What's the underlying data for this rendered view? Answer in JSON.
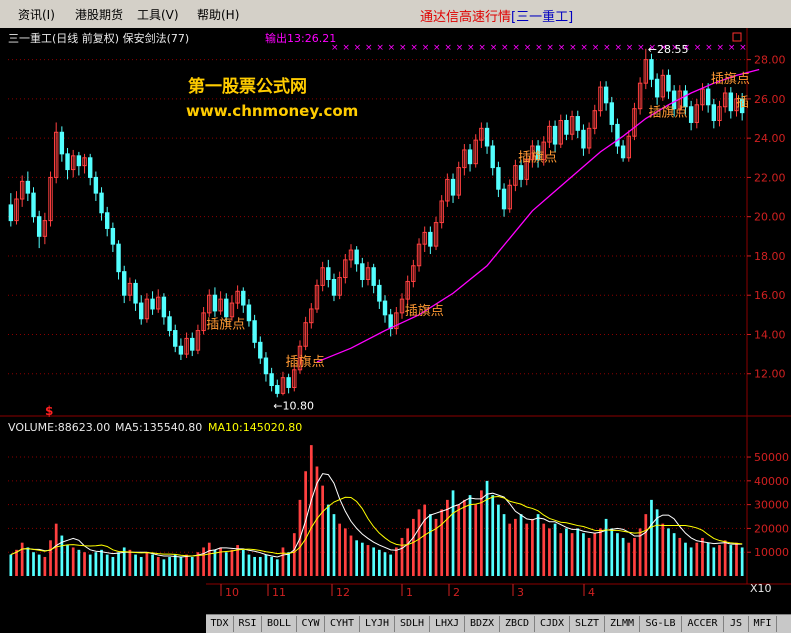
{
  "menu": {
    "items": [
      "资讯(I)",
      "港股期货",
      "工具(V)",
      "帮助(H)"
    ]
  },
  "app": {
    "title": "通达信高速行情",
    "stock_tag": "[三一重工]"
  },
  "price_panel": {
    "header": "三一重工(日线 前复权) 保安剑法(77)",
    "output_label": "输出13:26.21",
    "watermark_line1": "第一股票公式网",
    "watermark_line2": "www.chnmoney.com",
    "max_label": "28.55",
    "min_label": "10.80",
    "signal_label": "插旗点",
    "signal_label_partial": "插",
    "dollar_marker": "$"
  },
  "volume_panel": {
    "label_volume": "VOLUME:88623.00",
    "label_ma5": "MA5:135540.80",
    "label_ma10": "MA10:145020.80",
    "scale_label": "X10"
  },
  "time_axis": {
    "labels": [
      "10",
      "11",
      "12",
      "1",
      "2",
      "3",
      "4"
    ]
  },
  "tabs": [
    "TDX",
    "RSI",
    "BOLL",
    "CYW",
    "CYHT",
    "LYJH",
    "SDLH",
    "LHXJ",
    "BDZX",
    "ZBCD",
    "CJDX",
    "SLZT",
    "ZLMM",
    "SG-LB",
    "ACCER",
    "JS",
    "MFI"
  ],
  "colors": {
    "up": "#ff4040",
    "down": "#54ffff",
    "ma_line": "#ff00ff",
    "ma5": "#ffffff",
    "ma10": "#ffff00",
    "signal": "#ff9933",
    "watermark": "#ffcc00",
    "grid": "#8b0000",
    "axis_text": "#d02020"
  },
  "chart_data": [
    {
      "type": "candlestick",
      "title": "三一重工(日线 前复权) 保安剑法(77)",
      "y_ticks": [
        12.0,
        14.0,
        16.0,
        18.0,
        20.0,
        22.0,
        24.0,
        26.0,
        28.0
      ],
      "ylim": [
        10.0,
        29.0
      ],
      "annotations": [
        {
          "text": "10.80",
          "value": 10.8,
          "kind": "min"
        },
        {
          "text": "28.55",
          "value": 28.55,
          "kind": "max"
        },
        {
          "text": "插旗点",
          "bar": 38,
          "price": 14.3
        },
        {
          "text": "插旗点",
          "bar": 52,
          "price": 12.4
        },
        {
          "text": "插旗点",
          "bar": 73,
          "price": 15.0
        },
        {
          "text": "插旗点",
          "bar": 93,
          "price": 22.8
        },
        {
          "text": "插旗点",
          "bar": 116,
          "price": 25.1
        },
        {
          "text": "插旗点",
          "bar": 127,
          "price": 26.8
        }
      ],
      "signal_line": [
        [
          54,
          12.6
        ],
        [
          60,
          13.3
        ],
        [
          66,
          14.2
        ],
        [
          72,
          15.0
        ],
        [
          78,
          16.1
        ],
        [
          84,
          17.5
        ],
        [
          88,
          18.9
        ],
        [
          92,
          20.3
        ],
        [
          96,
          21.3
        ],
        [
          100,
          22.3
        ],
        [
          104,
          23.3
        ],
        [
          108,
          24.1
        ],
        [
          112,
          25.0
        ],
        [
          116,
          25.7
        ],
        [
          120,
          26.3
        ],
        [
          124,
          26.8
        ],
        [
          128,
          27.2
        ],
        [
          132,
          27.5
        ]
      ],
      "cross_markers_from_bar": 57,
      "candles": [
        [
          20.6,
          19.8,
          21.2,
          19.5
        ],
        [
          19.8,
          20.9,
          21.3,
          19.6
        ],
        [
          20.9,
          21.8,
          22.1,
          20.5
        ],
        [
          21.8,
          21.2,
          22.3,
          20.8
        ],
        [
          21.2,
          20.0,
          21.5,
          19.7
        ],
        [
          20.0,
          19.0,
          20.3,
          18.4
        ],
        [
          19.0,
          19.8,
          20.2,
          18.6
        ],
        [
          19.8,
          22.0,
          22.3,
          19.5
        ],
        [
          22.0,
          24.3,
          24.8,
          21.7
        ],
        [
          24.3,
          23.2,
          24.6,
          22.8
        ],
        [
          23.2,
          22.4,
          23.5,
          21.9
        ],
        [
          22.4,
          23.1,
          23.4,
          22.0
        ],
        [
          23.1,
          22.6,
          23.3,
          22.1
        ],
        [
          22.6,
          23.0,
          23.2,
          22.2
        ],
        [
          23.0,
          22.0,
          23.2,
          21.6
        ],
        [
          22.0,
          21.2,
          22.3,
          20.8
        ],
        [
          21.2,
          20.2,
          21.5,
          19.8
        ],
        [
          20.2,
          19.4,
          20.5,
          19.0
        ],
        [
          19.4,
          18.6,
          19.7,
          18.2
        ],
        [
          18.6,
          17.2,
          18.8,
          16.8
        ],
        [
          17.2,
          16.0,
          17.5,
          15.6
        ],
        [
          16.0,
          16.6,
          16.9,
          15.7
        ],
        [
          16.6,
          15.6,
          16.8,
          15.2
        ],
        [
          15.6,
          14.8,
          16.0,
          14.5
        ],
        [
          14.8,
          15.8,
          16.1,
          14.6
        ],
        [
          15.8,
          15.3,
          16.2,
          15.0
        ],
        [
          15.3,
          15.9,
          16.3,
          15.1
        ],
        [
          15.9,
          14.9,
          16.1,
          14.5
        ],
        [
          14.9,
          14.2,
          15.2,
          13.9
        ],
        [
          14.2,
          13.4,
          14.5,
          13.1
        ],
        [
          13.4,
          13.0,
          13.8,
          12.7
        ],
        [
          13.0,
          13.8,
          14.1,
          12.8
        ],
        [
          13.8,
          13.2,
          14.1,
          12.9
        ],
        [
          13.2,
          14.2,
          14.5,
          13.0
        ],
        [
          14.2,
          15.1,
          15.4,
          14.0
        ],
        [
          15.1,
          16.0,
          16.3,
          14.9
        ],
        [
          16.0,
          15.2,
          16.4,
          14.9
        ],
        [
          15.2,
          15.8,
          16.2,
          15.0
        ],
        [
          15.8,
          14.9,
          16.1,
          14.6
        ],
        [
          14.9,
          15.6,
          16.0,
          14.7
        ],
        [
          15.6,
          16.2,
          16.5,
          15.3
        ],
        [
          16.2,
          15.5,
          16.4,
          15.1
        ],
        [
          15.5,
          14.7,
          15.8,
          14.4
        ],
        [
          14.7,
          13.6,
          15.0,
          13.3
        ],
        [
          13.6,
          12.8,
          13.9,
          12.5
        ],
        [
          12.8,
          12.0,
          13.1,
          11.6
        ],
        [
          12.0,
          11.4,
          12.3,
          11.1
        ],
        [
          11.4,
          11.0,
          11.7,
          10.8
        ],
        [
          11.0,
          11.8,
          12.1,
          10.9
        ],
        [
          11.8,
          11.3,
          12.0,
          11.0
        ],
        [
          11.3,
          12.2,
          12.5,
          11.1
        ],
        [
          12.2,
          13.4,
          13.7,
          12.0
        ],
        [
          13.4,
          14.6,
          14.9,
          13.2
        ],
        [
          14.6,
          15.3,
          15.6,
          14.3
        ],
        [
          15.3,
          16.5,
          16.8,
          15.1
        ],
        [
          16.5,
          17.4,
          17.7,
          16.2
        ],
        [
          17.4,
          16.8,
          17.8,
          16.4
        ],
        [
          16.8,
          16.0,
          17.1,
          15.7
        ],
        [
          16.0,
          16.9,
          17.2,
          15.8
        ],
        [
          16.9,
          17.8,
          18.1,
          16.6
        ],
        [
          17.8,
          18.3,
          18.6,
          17.4
        ],
        [
          18.3,
          17.6,
          18.5,
          17.2
        ],
        [
          17.6,
          16.8,
          17.9,
          16.4
        ],
        [
          16.8,
          17.4,
          17.7,
          16.5
        ],
        [
          17.4,
          16.5,
          17.6,
          16.1
        ],
        [
          16.5,
          15.7,
          16.8,
          15.3
        ],
        [
          15.7,
          15.0,
          16.0,
          14.6
        ],
        [
          15.0,
          14.3,
          15.3,
          13.9
        ],
        [
          14.3,
          15.1,
          15.4,
          14.0
        ],
        [
          15.1,
          15.8,
          16.1,
          14.8
        ],
        [
          15.8,
          16.7,
          17.0,
          15.5
        ],
        [
          16.7,
          17.5,
          17.8,
          16.4
        ],
        [
          17.5,
          18.6,
          18.9,
          17.2
        ],
        [
          18.6,
          19.2,
          19.5,
          18.2
        ],
        [
          19.2,
          18.5,
          19.5,
          18.1
        ],
        [
          18.5,
          19.7,
          20.0,
          18.3
        ],
        [
          19.7,
          20.8,
          21.1,
          19.4
        ],
        [
          20.8,
          21.9,
          22.2,
          20.5
        ],
        [
          21.9,
          21.1,
          22.2,
          20.7
        ],
        [
          21.1,
          22.5,
          22.8,
          20.9
        ],
        [
          22.5,
          23.4,
          23.7,
          22.1
        ],
        [
          23.4,
          22.7,
          23.7,
          22.3
        ],
        [
          22.7,
          23.9,
          24.2,
          22.5
        ],
        [
          23.9,
          24.5,
          24.8,
          23.5
        ],
        [
          24.5,
          23.6,
          24.8,
          23.2
        ],
        [
          23.6,
          22.5,
          23.9,
          22.1
        ],
        [
          22.5,
          21.4,
          22.8,
          21.0
        ],
        [
          21.4,
          20.4,
          21.7,
          20.0
        ],
        [
          20.4,
          21.6,
          21.9,
          20.2
        ],
        [
          21.6,
          22.6,
          22.9,
          21.3
        ],
        [
          22.6,
          21.9,
          22.9,
          21.5
        ],
        [
          21.9,
          22.9,
          23.2,
          21.6
        ],
        [
          22.9,
          23.6,
          23.9,
          22.5
        ],
        [
          23.6,
          22.9,
          23.9,
          22.5
        ],
        [
          22.9,
          23.8,
          24.1,
          22.6
        ],
        [
          23.8,
          24.6,
          24.9,
          23.5
        ],
        [
          24.6,
          23.7,
          24.9,
          23.3
        ],
        [
          23.7,
          24.9,
          25.2,
          23.5
        ],
        [
          24.9,
          24.2,
          25.2,
          23.9
        ],
        [
          24.2,
          25.1,
          25.4,
          23.9
        ],
        [
          25.1,
          24.4,
          25.4,
          24.0
        ],
        [
          24.4,
          23.5,
          24.7,
          23.1
        ],
        [
          23.5,
          24.5,
          24.8,
          23.2
        ],
        [
          24.5,
          25.4,
          25.7,
          24.2
        ],
        [
          25.4,
          26.6,
          26.9,
          25.1
        ],
        [
          26.6,
          25.8,
          26.9,
          25.4
        ],
        [
          25.8,
          24.7,
          26.1,
          24.3
        ],
        [
          24.7,
          23.6,
          25.0,
          23.2
        ],
        [
          23.6,
          23.0,
          23.9,
          22.8
        ],
        [
          23.0,
          24.1,
          24.4,
          22.8
        ],
        [
          24.1,
          25.5,
          25.8,
          23.9
        ],
        [
          25.5,
          26.8,
          27.1,
          25.2
        ],
        [
          26.8,
          28.0,
          28.55,
          26.5
        ],
        [
          28.0,
          27.0,
          28.3,
          26.6
        ],
        [
          27.0,
          26.1,
          27.3,
          25.7
        ],
        [
          26.1,
          27.2,
          27.5,
          25.9
        ],
        [
          27.2,
          26.4,
          27.5,
          26.0
        ],
        [
          26.4,
          25.5,
          26.7,
          25.1
        ],
        [
          25.5,
          26.4,
          26.7,
          25.2
        ],
        [
          26.4,
          25.6,
          26.7,
          25.2
        ],
        [
          25.6,
          24.8,
          25.9,
          24.4
        ],
        [
          24.8,
          25.7,
          26.0,
          24.5
        ],
        [
          25.7,
          26.5,
          26.8,
          25.4
        ],
        [
          26.5,
          25.7,
          26.8,
          25.3
        ],
        [
          25.7,
          24.9,
          26.0,
          24.5
        ],
        [
          24.9,
          25.6,
          25.9,
          24.6
        ],
        [
          25.6,
          26.3,
          26.6,
          25.3
        ],
        [
          26.3,
          25.4,
          26.6,
          25.0
        ],
        [
          25.4,
          26.0,
          26.3,
          25.1
        ],
        [
          26.0,
          25.3,
          26.3,
          24.9
        ]
      ]
    },
    {
      "type": "volume",
      "y_ticks": [
        10000,
        20000,
        30000,
        40000,
        50000
      ],
      "ylim": [
        0,
        58000
      ],
      "volumes": [
        9000,
        11000,
        14000,
        12000,
        10000,
        9000,
        8000,
        15000,
        22000,
        17000,
        13000,
        12000,
        11000,
        10000,
        9000,
        10000,
        11000,
        9000,
        8000,
        10000,
        12000,
        11000,
        9000,
        8000,
        10000,
        9000,
        8000,
        7000,
        8000,
        9000,
        8000,
        9000,
        8000,
        10000,
        12000,
        14000,
        11000,
        12000,
        10000,
        11000,
        13000,
        11000,
        9000,
        8000,
        8000,
        9000,
        8000,
        7000,
        12000,
        10000,
        18000,
        32000,
        44000,
        55000,
        46000,
        38000,
        30000,
        26000,
        22000,
        20000,
        17000,
        15000,
        14000,
        13000,
        12000,
        11000,
        10000,
        9000,
        12000,
        16000,
        20000,
        24000,
        28000,
        30000,
        26000,
        24000,
        28000,
        32000,
        36000,
        30000,
        32000,
        34000,
        30000,
        36000,
        40000,
        34000,
        30000,
        26000,
        22000,
        24000,
        26000,
        22000,
        24000,
        26000,
        22000,
        20000,
        22000,
        18000,
        20000,
        18000,
        20000,
        18000,
        16000,
        18000,
        20000,
        24000,
        20000,
        18000,
        16000,
        14000,
        16000,
        20000,
        26000,
        32000,
        28000,
        22000,
        20000,
        18000,
        16000,
        14000,
        12000,
        14000,
        16000,
        14000,
        12000,
        13000,
        15000,
        13000,
        14000,
        12000
      ]
    }
  ]
}
